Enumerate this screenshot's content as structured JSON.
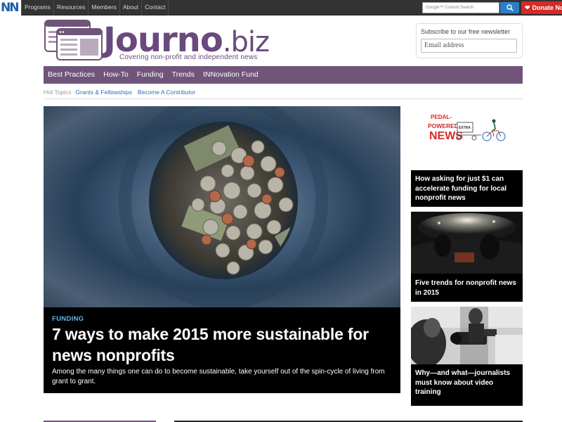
{
  "topbar": {
    "logo_text": "NN",
    "nav": [
      "Programs",
      "Resources",
      "Members",
      "About",
      "Contact"
    ],
    "search_placeholder": "Google™ Custom Search",
    "search_icon": "search-icon",
    "donate_label": "Donate Now",
    "donate_icon": "heart-icon",
    "donate_color": "#d42b27"
  },
  "masthead": {
    "site_name_main": "Journo",
    "site_name_tld": ".biz",
    "tagline": "Covering non-profit and independent news",
    "brand_color": "#705479"
  },
  "newsletter": {
    "label": "Subscribe to our free newsletter",
    "placeholder": "Email address"
  },
  "mainnav": {
    "items": [
      "Best Practices",
      "How-To",
      "Funding",
      "Trends",
      "INNovation Fund"
    ]
  },
  "hot_topics": {
    "label": "Hot Topics",
    "links": [
      "Grants & Fellowships",
      "Become A Contributor"
    ]
  },
  "hero": {
    "category": "FUNDING",
    "title": "7 ways to make 2015 more sustainable for news nonprofits",
    "dek": "Among the many things one can do to become sustainable, take yourself out of the spin-cycle of living from grant to grant."
  },
  "sidebar": {
    "ad_line1": "PEDAL-",
    "ad_line2": "POWERED",
    "ad_line3": "NEWS",
    "ad_badge": "EXTRA",
    "cards": [
      {
        "title": "How asking for just $1 can accelerate funding for local nonprofit news"
      },
      {
        "title": "Five trends for nonprofit news in 2015"
      },
      {
        "title": "Why—and what—journalists must know about video training"
      }
    ]
  }
}
